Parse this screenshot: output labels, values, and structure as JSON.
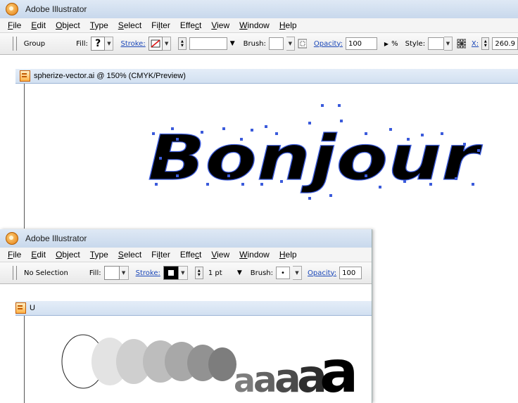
{
  "window1": {
    "title": "Adobe Illustrator",
    "menu": [
      {
        "pre": "",
        "u": "F",
        "post": "ile"
      },
      {
        "pre": "",
        "u": "E",
        "post": "dit"
      },
      {
        "pre": "",
        "u": "O",
        "post": "bject"
      },
      {
        "pre": "",
        "u": "T",
        "post": "ype"
      },
      {
        "pre": "",
        "u": "S",
        "post": "elect"
      },
      {
        "pre": "Fi",
        "u": "l",
        "post": "ter"
      },
      {
        "pre": "Effe",
        "u": "c",
        "post": "t"
      },
      {
        "pre": "",
        "u": "V",
        "post": "iew"
      },
      {
        "pre": "",
        "u": "W",
        "post": "indow"
      },
      {
        "pre": "",
        "u": "H",
        "post": "elp"
      }
    ],
    "toolbar": {
      "selection": "Group",
      "fill_label": "Fill:",
      "fill_value": "?",
      "stroke_label": "Stroke:",
      "brush_label": "Brush:",
      "opacity_label": "Opacity:",
      "opacity_value": "100",
      "opacity_unit": "%",
      "style_label": "Style:",
      "x_label": "X:",
      "x_value": "260.9"
    },
    "document_tab": "spherize-vector.ai @ 150% (CMYK/Preview)",
    "artwork_text": "Bonjour",
    "selection_color": "#3b5bdb"
  },
  "window2": {
    "title": "Adobe Illustrator",
    "menu": [
      {
        "pre": "",
        "u": "F",
        "post": "ile"
      },
      {
        "pre": "",
        "u": "E",
        "post": "dit"
      },
      {
        "pre": "",
        "u": "O",
        "post": "bject"
      },
      {
        "pre": "",
        "u": "T",
        "post": "ype"
      },
      {
        "pre": "",
        "u": "S",
        "post": "elect"
      },
      {
        "pre": "Fi",
        "u": "l",
        "post": "ter"
      },
      {
        "pre": "Effe",
        "u": "c",
        "post": "t"
      },
      {
        "pre": "",
        "u": "V",
        "post": "iew"
      },
      {
        "pre": "",
        "u": "W",
        "post": "indow"
      },
      {
        "pre": "",
        "u": "H",
        "post": "elp"
      }
    ],
    "toolbar": {
      "selection": "No Selection",
      "fill_label": "Fill:",
      "stroke_label": "Stroke:",
      "stroke_weight": "1 pt",
      "brush_label": "Brush:",
      "brush_value": "•",
      "opacity_label": "Opacity:",
      "opacity_value": "100"
    },
    "document_tab": "U",
    "blend_letter": "a",
    "blend_colors": [
      "#ffffff",
      "#e3e3e3",
      "#cfcfcf",
      "#bdbdbd",
      "#a8a8a8",
      "#929292",
      "#7d7d7d",
      "#636363",
      "#4a4a4a",
      "#2e2e2e",
      "#000000"
    ]
  }
}
